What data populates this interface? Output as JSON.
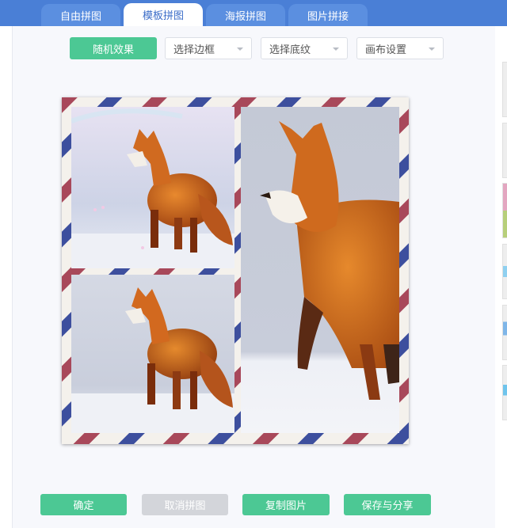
{
  "tabs": [
    {
      "label": "自由拼图",
      "active": false
    },
    {
      "label": "模板拼图",
      "active": true
    },
    {
      "label": "海报拼图",
      "active": false
    },
    {
      "label": "图片拼接",
      "active": false
    }
  ],
  "toolbar": {
    "random_label": "随机效果",
    "border_select": "选择边框",
    "texture_select": "选择底纹",
    "canvas_select": "画布设置"
  },
  "actions": {
    "confirm_label": "确定",
    "cancel_label": "取消拼图",
    "copy_label": "复制图片",
    "save_label": "保存与分享"
  },
  "colors": {
    "tab_bar": "#4a7fd6",
    "accent_green": "#4cc894",
    "disabled_gray": "#d3d5da",
    "airmail_red": "#a8485a",
    "airmail_blue": "#3d4f9e"
  },
  "collage": {
    "frame_style": "airmail",
    "photos": [
      "fox-top-left",
      "fox-bottom-left",
      "fox-right"
    ]
  }
}
